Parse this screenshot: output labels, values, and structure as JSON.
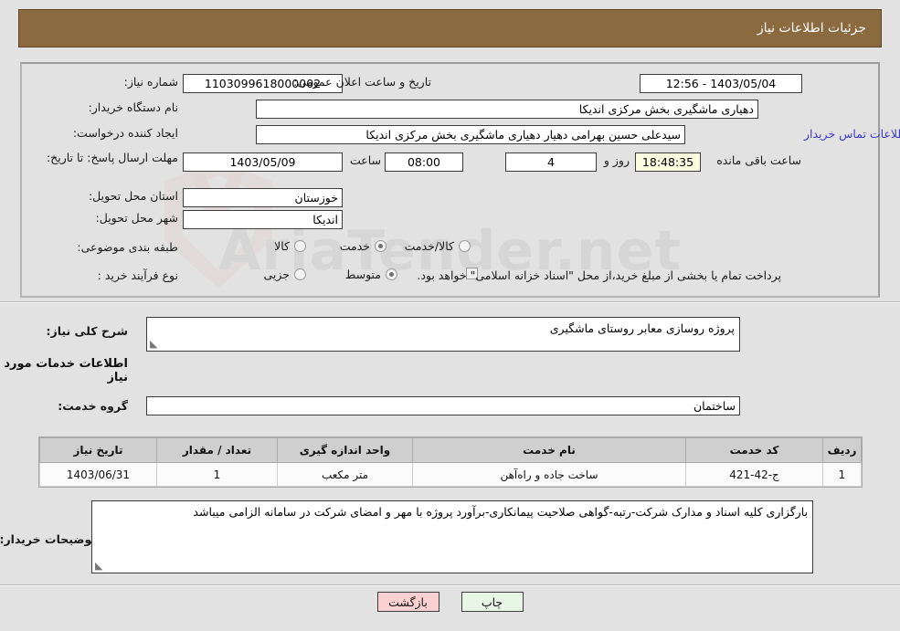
{
  "header": {
    "title": "جزئیات اطلاعات نیاز"
  },
  "fields": {
    "need_number_label": "شماره نیاز:",
    "need_number_value": "1103099618000002",
    "announce_label": "تاریخ و ساعت اعلان عمومی:",
    "announce_value": "1403/05/04 - 12:56",
    "buyer_org_label": "نام دستگاه خریدار:",
    "buyer_org_value": "دهیاری ماشگیری بخش مرکزی اندیکا",
    "creator_label": "ایجاد کننده درخواست:",
    "creator_value": "سیدعلی حسین بهرامی دهیار دهیاری ماشگیری بخش مرکزی اندیکا",
    "contact_link": "اطلاعات تماس خریدار",
    "deadline_label": "مهلت ارسال پاسخ: تا تاریخ:",
    "deadline_date": "1403/05/09",
    "time_label": "ساعت",
    "deadline_time": "08:00",
    "days_left": "4",
    "days_word": "روز و",
    "time_left": "18:48:35",
    "time_left_suffix": "ساعت باقی مانده",
    "province_label": "استان محل تحویل:",
    "province_value": "خوزستان",
    "city_label": "شهر محل تحویل:",
    "city_value": "اندیکا",
    "category_label": "طبقه بندی موضوعی:",
    "process_label": "نوع فرآیند خرید :",
    "payment_note": "پرداخت تمام یا بخشی از مبلغ خرید،از محل \"اسناد خزانه اسلامی\" خواهد بود."
  },
  "category_options": [
    {
      "label": "کالا",
      "selected": false
    },
    {
      "label": "خدمت",
      "selected": true
    },
    {
      "label": "کالا/خدمت",
      "selected": false
    }
  ],
  "process_options": [
    {
      "label": "جزیی",
      "selected": false
    },
    {
      "label": "متوسط",
      "selected": true
    }
  ],
  "description": {
    "label": "شرح کلی نیاز:",
    "value": "پروژه روسازی معابر روستای ماشگیری"
  },
  "services_section": {
    "title": "اطلاعات خدمات مورد نیاز",
    "group_label": "گروه خدمت:",
    "group_value": "ساختمان"
  },
  "table": {
    "columns": [
      "ردیف",
      "کد خدمت",
      "نام خدمت",
      "واحد اندازه گیری",
      "تعداد / مقدار",
      "تاریخ نیاز"
    ],
    "rows": [
      {
        "index": "1",
        "code": "ج-42-421",
        "name": "ساخت جاده و راه‌آهن",
        "unit": "متر مکعب",
        "qty": "1",
        "need_date": "1403/06/31"
      }
    ]
  },
  "notes": {
    "label": "توضیحات خریدار:",
    "value": "بارگزاری کلیه اسناد و مدارک شرکت-رتبه-گواهی صلاحیت پیمانکاری-برآورد پروژه با مهر و امضای شرکت در سامانه الزامی میباشد"
  },
  "footer": {
    "print_label": "چاپ",
    "back_label": "بازگشت"
  },
  "watermark": {
    "text": "AriaTender.net"
  },
  "colors": {
    "header_bg": "#8c6a3f",
    "page_bg": "#e2e2e2",
    "link": "#3b3bc8",
    "table_header_bg": "#cfcfcf",
    "print_btn_bg": "#e8f6e6",
    "back_btn_bg": "#fbd0d0",
    "countdown_bg": "#fbfbdf"
  }
}
